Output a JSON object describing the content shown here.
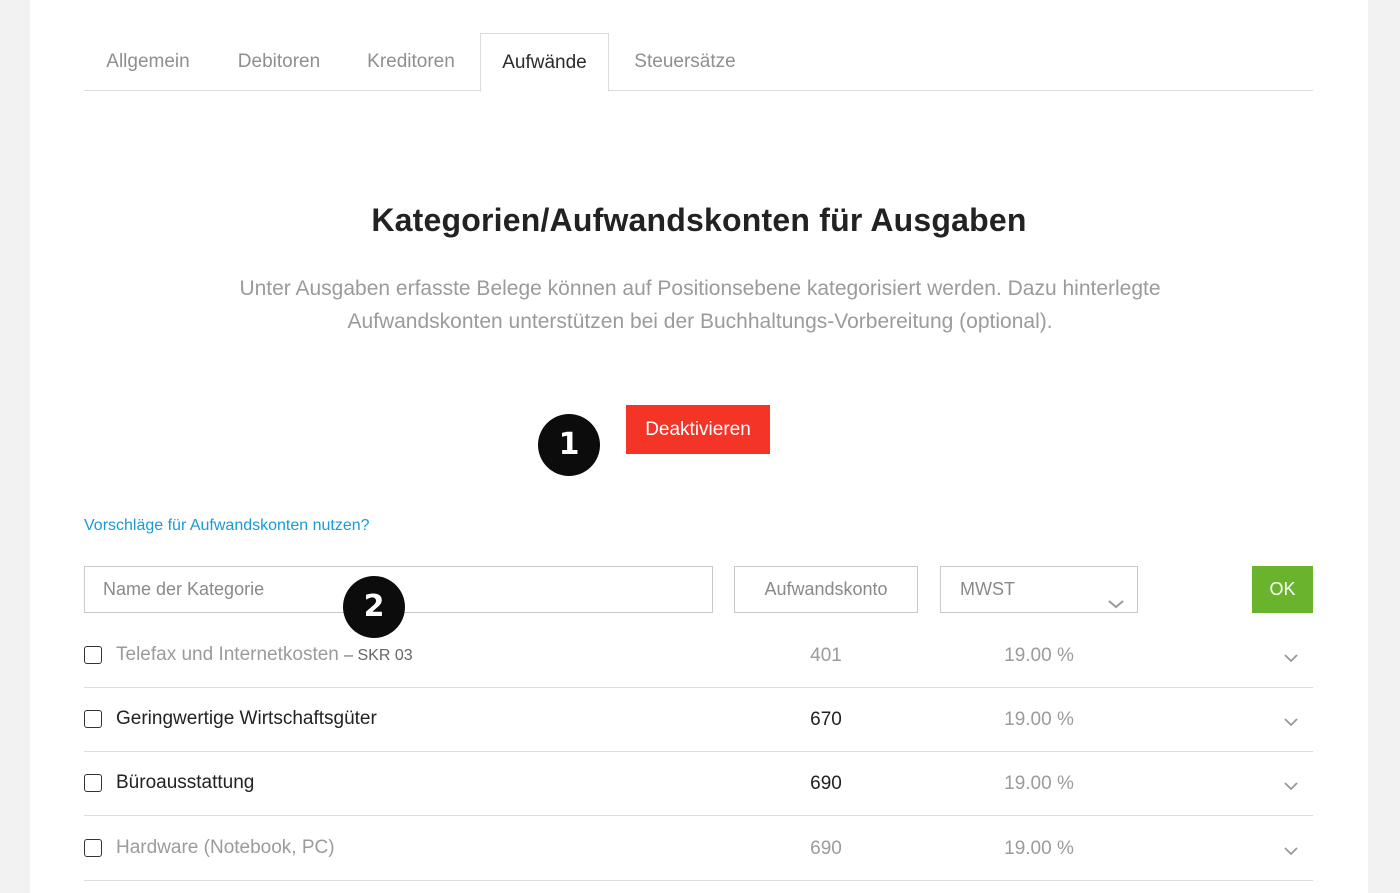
{
  "tabs": [
    {
      "label": "Allgemein",
      "active": false
    },
    {
      "label": "Debitoren",
      "active": false
    },
    {
      "label": "Kreditoren",
      "active": false
    },
    {
      "label": "Aufwände",
      "active": true
    },
    {
      "label": "Steuersätze",
      "active": false
    }
  ],
  "heading": {
    "title": "Kategorien/Aufwandskonten für Ausgaben",
    "subtitle_line1": "Unter Ausgaben erfasste Belege können auf Positionsebene kategorisiert werden. Dazu hinterlegte",
    "subtitle_line2": "Aufwandskonten unterstützen bei der Buchhaltungs-Vorbereitung (optional)."
  },
  "deactivate_label": "Deaktivieren",
  "markers": [
    "1",
    "2"
  ],
  "suggest_link": "Vorschläge für Aufwandskonten nutzen?",
  "form": {
    "name_placeholder": "Name der Kategorie",
    "account_placeholder": "Aufwandskonto",
    "vat_selected": "MWST",
    "ok_label": "OK"
  },
  "categories": [
    {
      "name": "Telefax und Internetkosten",
      "tag": "– SKR 03",
      "account": "401",
      "rate": "19.00 %",
      "muted": true
    },
    {
      "name": "Geringwertige Wirtschaftsgüter",
      "tag": "",
      "account": "670",
      "rate": "19.00 %",
      "muted": false
    },
    {
      "name": "Büroausstattung",
      "tag": "",
      "account": "690",
      "rate": "19.00 %",
      "muted": false
    },
    {
      "name": "Hardware (Notebook, PC)",
      "tag": "",
      "account": "690",
      "rate": "19.00 %",
      "muted": true
    }
  ],
  "colors": {
    "deactivate": "#f53428",
    "ok": "#6ab42d",
    "link": "#1a9ad6",
    "marker": "#0c0c0c"
  },
  "icons": {
    "dropdown": "chevron-down-icon",
    "checkbox": "checkbox-unchecked"
  }
}
